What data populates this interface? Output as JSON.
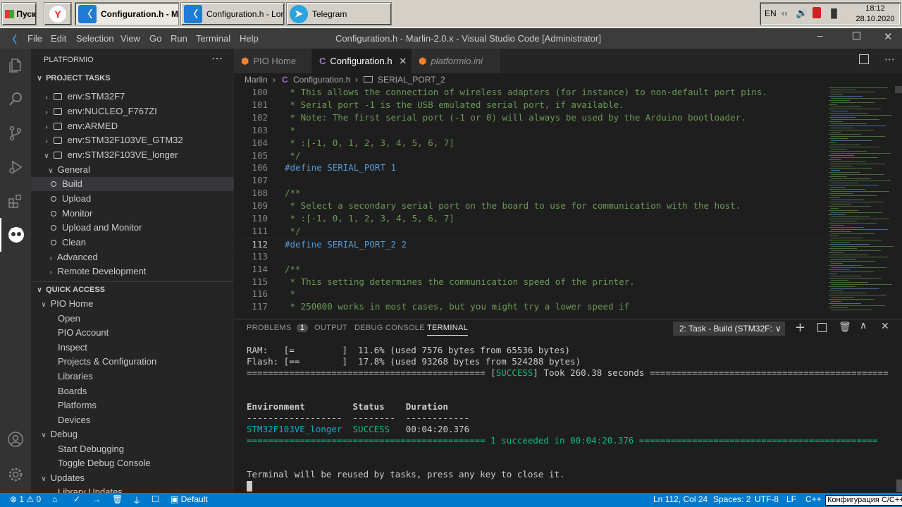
{
  "taskbar": {
    "start_label": "Пуск",
    "buttons": [
      {
        "label": "Configuration.h - M..."
      },
      {
        "label": "Configuration.h - Lon..."
      },
      {
        "label": "Telegram"
      }
    ],
    "lang": "EN",
    "time": "18:12",
    "date": "28.10.2020"
  },
  "window": {
    "title": "Configuration.h - Marlin-2.0.x - Visual Studio Code [Administrator]",
    "menu": [
      "File",
      "Edit",
      "Selection",
      "View",
      "Go",
      "Run",
      "Terminal",
      "Help"
    ]
  },
  "sidebar": {
    "title": "PLATFORMIO",
    "project_tasks_header": "PROJECT TASKS",
    "envs": [
      "env:STM32F7",
      "env:NUCLEO_F767ZI",
      "env:ARMED",
      "env:STM32F103VE_GTM32",
      "env:STM32F103VE_longer"
    ],
    "general_label": "General",
    "tasks": [
      "Build",
      "Upload",
      "Monitor",
      "Upload and Monitor",
      "Clean"
    ],
    "advanced_label": "Advanced",
    "remote_label": "Remote Development",
    "quick_access_header": "QUICK ACCESS",
    "pio_home_label": "PIO Home",
    "pio_home_items": [
      "Open",
      "PIO Account",
      "Inspect",
      "Projects & Configuration",
      "Libraries",
      "Boards",
      "Platforms",
      "Devices"
    ],
    "debug_label": "Debug",
    "debug_items": [
      "Start Debugging",
      "Toggle Debug Console"
    ],
    "updates_label": "Updates",
    "updates_items": [
      "Library Updates"
    ]
  },
  "editor": {
    "tabs": [
      {
        "label": "PIO Home"
      },
      {
        "label": "Configuration.h"
      },
      {
        "label": "platformio.ini"
      }
    ],
    "breadcrumb": [
      "Marlin",
      "Configuration.h",
      "SERIAL_PORT_2"
    ],
    "cursor_line": 112
  },
  "code_lines": [
    {
      "n": "100",
      "t": " * This allows the connection of wireless adapters (for instance) to non-default port pins."
    },
    {
      "n": "101",
      "t": " * Serial port -1 is the USB emulated serial port, if available."
    },
    {
      "n": "102",
      "t": " * Note: The first serial port (-1 or 0) will always be used by the Arduino bootloader."
    },
    {
      "n": "103",
      "t": " *"
    },
    {
      "n": "104",
      "t": " * :[-1, 0, 1, 2, 3, 4, 5, 6, 7]"
    },
    {
      "n": "105",
      "t": " */"
    },
    {
      "n": "106",
      "t": "#define SERIAL_PORT 1"
    },
    {
      "n": "107",
      "t": ""
    },
    {
      "n": "108",
      "t": "/**"
    },
    {
      "n": "109",
      "t": " * Select a secondary serial port on the board to use for communication with the host."
    },
    {
      "n": "110",
      "t": " * :[-1, 0, 1, 2, 3, 4, 5, 6, 7]"
    },
    {
      "n": "111",
      "t": " */"
    },
    {
      "n": "112",
      "t": "#define SERIAL_PORT_2 2"
    },
    {
      "n": "113",
      "t": ""
    },
    {
      "n": "114",
      "t": "/**"
    },
    {
      "n": "115",
      "t": " * This setting determines the communication speed of the printer."
    },
    {
      "n": "116",
      "t": " *"
    },
    {
      "n": "117",
      "t": " * 250000 works in most cases, but you might try a lower speed if"
    }
  ],
  "panel": {
    "tabs": [
      "PROBLEMS",
      "OUTPUT",
      "DEBUG CONSOLE",
      "TERMINAL"
    ],
    "problems_count": "1",
    "terminal_select": "2: Task - Build (STM32F:"
  },
  "terminal": {
    "ram_line": "RAM:   [=         ]  11.6% (used 7576 bytes from 65536 bytes)",
    "flash_line": "Flash: [==        ]  17.8% (used 93268 bytes from 524288 bytes)",
    "success_left": "============================================= [",
    "success_word": "SUCCESS",
    "success_right": "] Took 260.38 seconds =============================================",
    "table_header": "Environment         Status    Duration",
    "table_sep": "------------------  --------  ------------",
    "row_env": "STM32F103VE_longer",
    "row_status": "SUCCESS",
    "row_duration": "00:04:20.376",
    "summary": "============================================= 1 succeeded in 00:04:20.376 =============================================",
    "reuse_msg": "Terminal will be reused by tasks, press any key to close it."
  },
  "status": {
    "errors": "1",
    "warnings": "0",
    "env_label": "Default",
    "position": "Ln 112, Col 24",
    "spaces": "Spaces: 2",
    "encoding": "UTF-8",
    "eol": "LF",
    "language": "C++",
    "config": "Конфигурация C/C++"
  }
}
